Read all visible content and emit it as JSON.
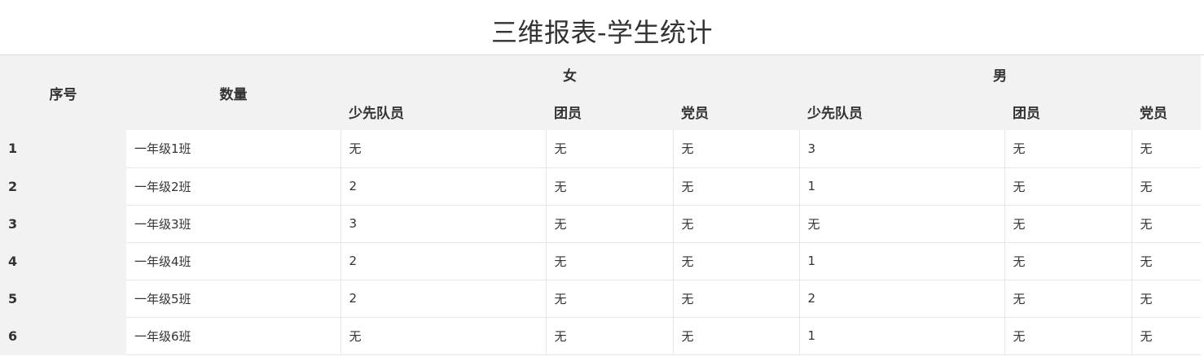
{
  "title": "三维报表-学生统计",
  "table": {
    "headers": {
      "seq": "序号",
      "count": "数量",
      "female": "女",
      "male": "男",
      "sub": [
        "少先队员",
        "团员",
        "党员",
        "少先队员",
        "团员",
        "党员"
      ]
    },
    "rows": [
      {
        "seq": "1",
        "cls": "一年级1班",
        "cells": [
          "无",
          "无",
          "无",
          "3",
          "无",
          "无"
        ]
      },
      {
        "seq": "2",
        "cls": "一年级2班",
        "cells": [
          "2",
          "无",
          "无",
          "1",
          "无",
          "无"
        ]
      },
      {
        "seq": "3",
        "cls": "一年级3班",
        "cells": [
          "3",
          "无",
          "无",
          "无",
          "无",
          "无"
        ]
      },
      {
        "seq": "4",
        "cls": "一年级4班",
        "cells": [
          "2",
          "无",
          "无",
          "1",
          "无",
          "无"
        ]
      },
      {
        "seq": "5",
        "cls": "一年级5班",
        "cells": [
          "2",
          "无",
          "无",
          "2",
          "无",
          "无"
        ]
      },
      {
        "seq": "6",
        "cls": "一年级6班",
        "cells": [
          "无",
          "无",
          "无",
          "1",
          "无",
          "无"
        ]
      }
    ]
  }
}
